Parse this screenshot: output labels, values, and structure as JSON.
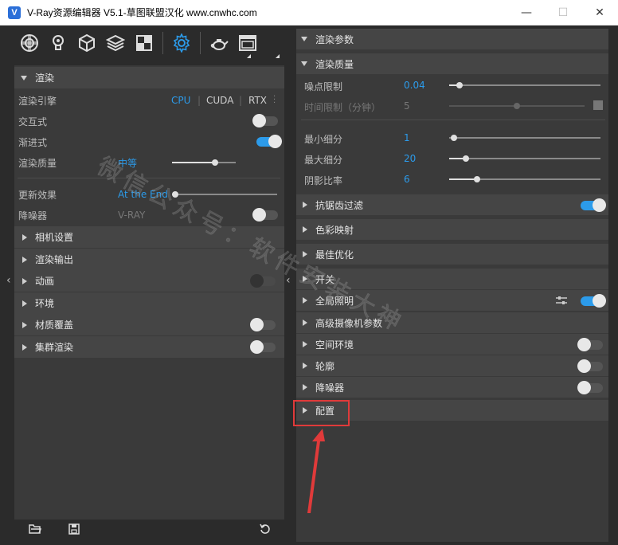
{
  "window": {
    "app_icon_letter": "V",
    "title": "V-Ray资源编辑器 V5.1-草图联盟汉化 www.cnwhc.com",
    "minimize": "—",
    "maximize": "☐",
    "close": "✕"
  },
  "toolbar": {
    "icons": [
      "material-icon",
      "light-icon",
      "geometry-icon",
      "layers-icon",
      "texture-icon",
      "settings-icon",
      "teapot-icon",
      "frame-buffer-icon"
    ],
    "active": "settings-icon"
  },
  "left": {
    "render_section": "渲染",
    "engine_label": "渲染引擎",
    "engines": [
      "CPU",
      "CUDA",
      "RTX"
    ],
    "engine_selected": "CPU",
    "interactive_label": "交互式",
    "interactive_on": false,
    "progressive_label": "渐进式",
    "progressive_on": true,
    "quality_label": "渲染质量",
    "quality_value": "中等",
    "update_label": "更新效果",
    "update_value": "At the End",
    "denoiser_label": "降噪器",
    "denoiser_value": "V-RAY",
    "denoiser_on": false,
    "sections": [
      {
        "label": "相机设置"
      },
      {
        "label": "渲染输出"
      },
      {
        "label": "动画",
        "toggle": false
      },
      {
        "label": "环境"
      },
      {
        "label": "材质覆盖",
        "toggle": false
      },
      {
        "label": "集群渲染",
        "toggle": false
      }
    ]
  },
  "right": {
    "top_section": "渲染参数",
    "quality_section": "渲染质量",
    "noise_label": "噪点限制",
    "noise_value": "0.04",
    "time_label": "时间限制（分钟）",
    "time_value": "5",
    "min_sub_label": "最小细分",
    "min_sub_value": "1",
    "max_sub_label": "最大细分",
    "max_sub_value": "20",
    "shadow_label": "阴影比率",
    "shadow_value": "6",
    "sections": [
      {
        "label": "抗锯齿过滤",
        "toggle": true
      },
      {
        "label": "色彩映射"
      },
      {
        "label": "最佳优化"
      },
      {
        "label": "开关"
      },
      {
        "label": "全局照明",
        "toggle": true
      },
      {
        "label": "高级摄像机参数"
      },
      {
        "label": "空间环境",
        "toggle": false
      },
      {
        "label": "轮廓",
        "toggle": false
      },
      {
        "label": "降噪器",
        "toggle": false
      },
      {
        "label": "配置"
      }
    ]
  },
  "watermark": "微信公众号：软件安装大神",
  "colors": {
    "accent": "#2c9bea",
    "highlight": "#e03a3a"
  }
}
